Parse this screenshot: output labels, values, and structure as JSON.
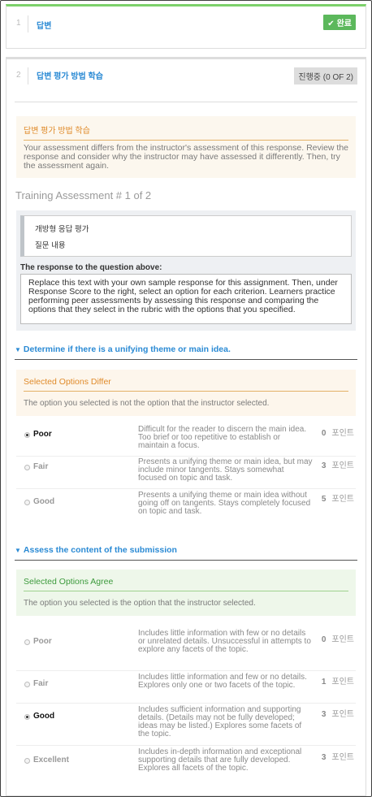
{
  "step1": {
    "number": "1",
    "title": "답변",
    "badge_icon": "check-icon",
    "badge": "완료",
    "colors": {
      "accent": "#7dd16b",
      "badge": "#5cb85c"
    }
  },
  "step2": {
    "number": "2",
    "title": "답변 평가 방법 학습",
    "progress": "진행중 (0 OF 2)",
    "note": {
      "title": "답변 평가 방법 학습",
      "body": "Your assessment differs from the instructor's assessment of this response. Review the response and consider why the instructor may have assessed it differently. Then, try the assessment again."
    },
    "training_title": "Training Assessment # 1 of 2",
    "prompt": {
      "line1": "개방형 응답 평가",
      "line2": "질문 내용"
    },
    "response_label": "The response to the question above:",
    "response_text": "Replace this text with your own sample response for this assignment. Then, under Response Score to the right, select an option for each criterion. Learners practice performing peer assessments by assessing this response and comparing the options that they select in the rubric with the options that you specified."
  },
  "criteria": [
    {
      "title": "Determine if there is a unifying theme or main idea.",
      "feedback_title": "Selected Options Differ",
      "feedback_body": "The option you selected is not the option that the instructor selected.",
      "options": [
        {
          "name": "Poor",
          "selected": true,
          "desc": "Difficult for the reader to discern the main idea.  Too brief or too repetitive to establish or maintain a focus.",
          "points": "0",
          "unit": "포인트"
        },
        {
          "name": "Fair",
          "selected": false,
          "desc": "Presents a unifying theme or main idea, but may include minor tangents.  Stays somewhat focused on topic and task.",
          "points": "3",
          "unit": "포인트"
        },
        {
          "name": "Good",
          "selected": false,
          "desc": "Presents a unifying theme or main idea without going off on tangents.  Stays completely focused on topic and task.",
          "points": "5",
          "unit": "포인트"
        }
      ]
    },
    {
      "title": "Assess the content of the submission",
      "feedback_title": "Selected Options Agree",
      "feedback_body": "The option you selected is the option that the instructor selected.",
      "options": [
        {
          "name": "Poor",
          "selected": false,
          "desc": "Includes little information with few or no details or unrelated details.  Unsuccessful in attempts to explore any facets of the topic.",
          "points": "0",
          "unit": "포인트"
        },
        {
          "name": "Fair",
          "selected": false,
          "desc": "Includes little information and few or no details.  Explores only one or two facets of the topic.",
          "points": "1",
          "unit": "포인트"
        },
        {
          "name": "Good",
          "selected": true,
          "desc": "Includes sufficient information and supporting details. (Details may not be fully developed; ideas may be listed.)  Explores some facets of the topic.",
          "points": "3",
          "unit": "포인트"
        },
        {
          "name": "Excellent",
          "selected": false,
          "desc": "Includes in-depth information and exceptional supporting details that are fully developed.  Explores all facets of the topic.",
          "points": "3",
          "unit": "포인트"
        }
      ]
    }
  ]
}
